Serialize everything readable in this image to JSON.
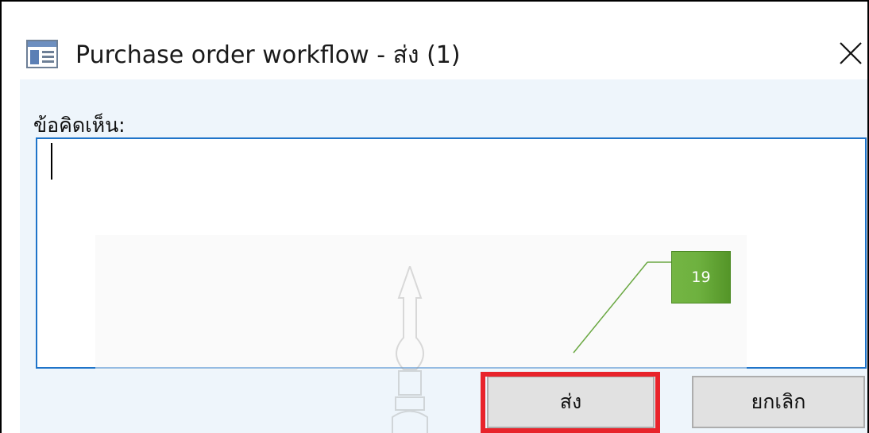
{
  "dialog": {
    "title": "Purchase order workflow - ส่ง (1)",
    "comment_label": "ข้อคิดเห็น:",
    "comment_value": "",
    "send_label": "ส่ง",
    "cancel_label": "ยกเลิก"
  },
  "annotation": {
    "step_number": "19",
    "highlight_color": "#e8232b",
    "badge_color": "#6eb13f"
  },
  "icons": {
    "window": "window-icon",
    "close": "close-icon",
    "emblem": "watermark-emblem-icon"
  },
  "colors": {
    "input_border": "#1f74c9",
    "content_bg": "#eef5fb"
  }
}
